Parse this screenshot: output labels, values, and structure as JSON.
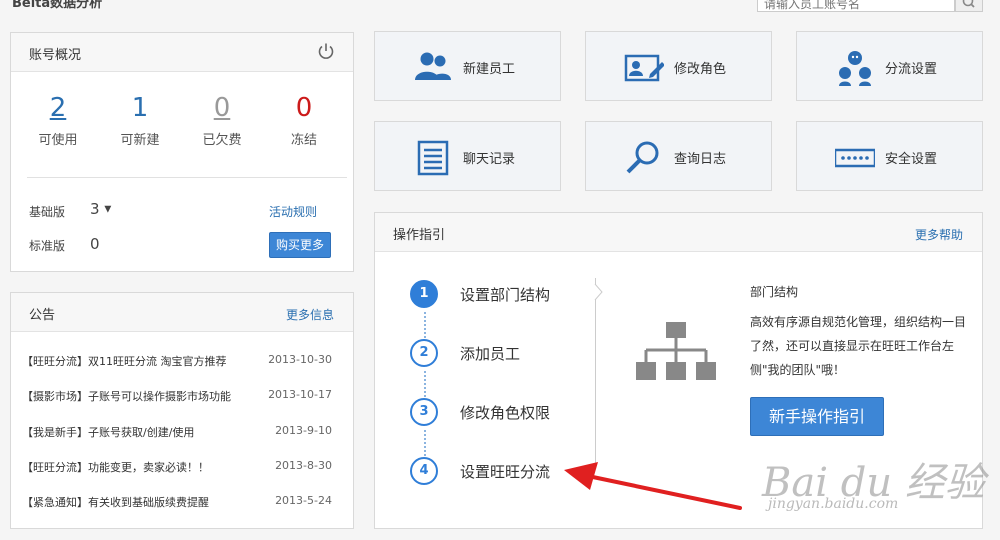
{
  "header": {
    "title": "Belta数据分析",
    "search_placeholder": "请输入员工账号名"
  },
  "account": {
    "title": "账号概况",
    "stats": [
      {
        "value": "2",
        "label": "可使用",
        "color": "#2a6fb0"
      },
      {
        "value": "1",
        "label": "可新建",
        "color": "#2a6fb0"
      },
      {
        "value": "0",
        "label": "已欠费",
        "color": "#999999"
      },
      {
        "value": "0",
        "label": "冻结",
        "color": "#cc1b1b"
      }
    ],
    "basic_label": "基础版",
    "basic_value": "3",
    "activity_link": "活动规则",
    "standard_label": "标准版",
    "standard_value": "0",
    "buy_button": "购买更多"
  },
  "notices": {
    "title": "公告",
    "more": "更多信息",
    "items": [
      {
        "text": "【旺旺分流】双11旺旺分流 淘宝官方推荐",
        "date": "2013-10-30"
      },
      {
        "text": "【摄影市场】子账号可以操作摄影市场功能",
        "date": "2013-10-17"
      },
      {
        "text": "【我是新手】子账号获取/创建/使用",
        "date": "2013-9-10"
      },
      {
        "text": "【旺旺分流】功能变更，卖家必读！！",
        "date": "2013-8-30"
      },
      {
        "text": "【紧急通知】有关收到基础版续费提醒",
        "date": "2013-5-24"
      }
    ]
  },
  "tiles": [
    {
      "label": "新建员工",
      "icon": "users-icon"
    },
    {
      "label": "修改角色",
      "icon": "edit-card-icon"
    },
    {
      "label": "分流设置",
      "icon": "bots-icon"
    },
    {
      "label": "聊天记录",
      "icon": "document-icon"
    },
    {
      "label": "查询日志",
      "icon": "magnifier-icon"
    },
    {
      "label": "安全设置",
      "icon": "password-icon"
    }
  ],
  "guide": {
    "title": "操作指引",
    "more": "更多帮助",
    "steps": [
      {
        "num": "1",
        "label": "设置部门结构"
      },
      {
        "num": "2",
        "label": "添加员工"
      },
      {
        "num": "3",
        "label": "修改角色权限"
      },
      {
        "num": "4",
        "label": "设置旺旺分流"
      }
    ],
    "detail_title": "部门结构",
    "detail_body": "高效有序源自规范化管理，组织结构一目了然，还可以直接显示在旺旺工作台左侧\"我的团队\"哦！",
    "button": "新手操作指引"
  },
  "watermark": {
    "line1": "Bai du 经验",
    "line2": "jingyan.baidu.com"
  },
  "colors": {
    "accent": "#2f7ed8",
    "annotation_arrow": "#e02020"
  }
}
